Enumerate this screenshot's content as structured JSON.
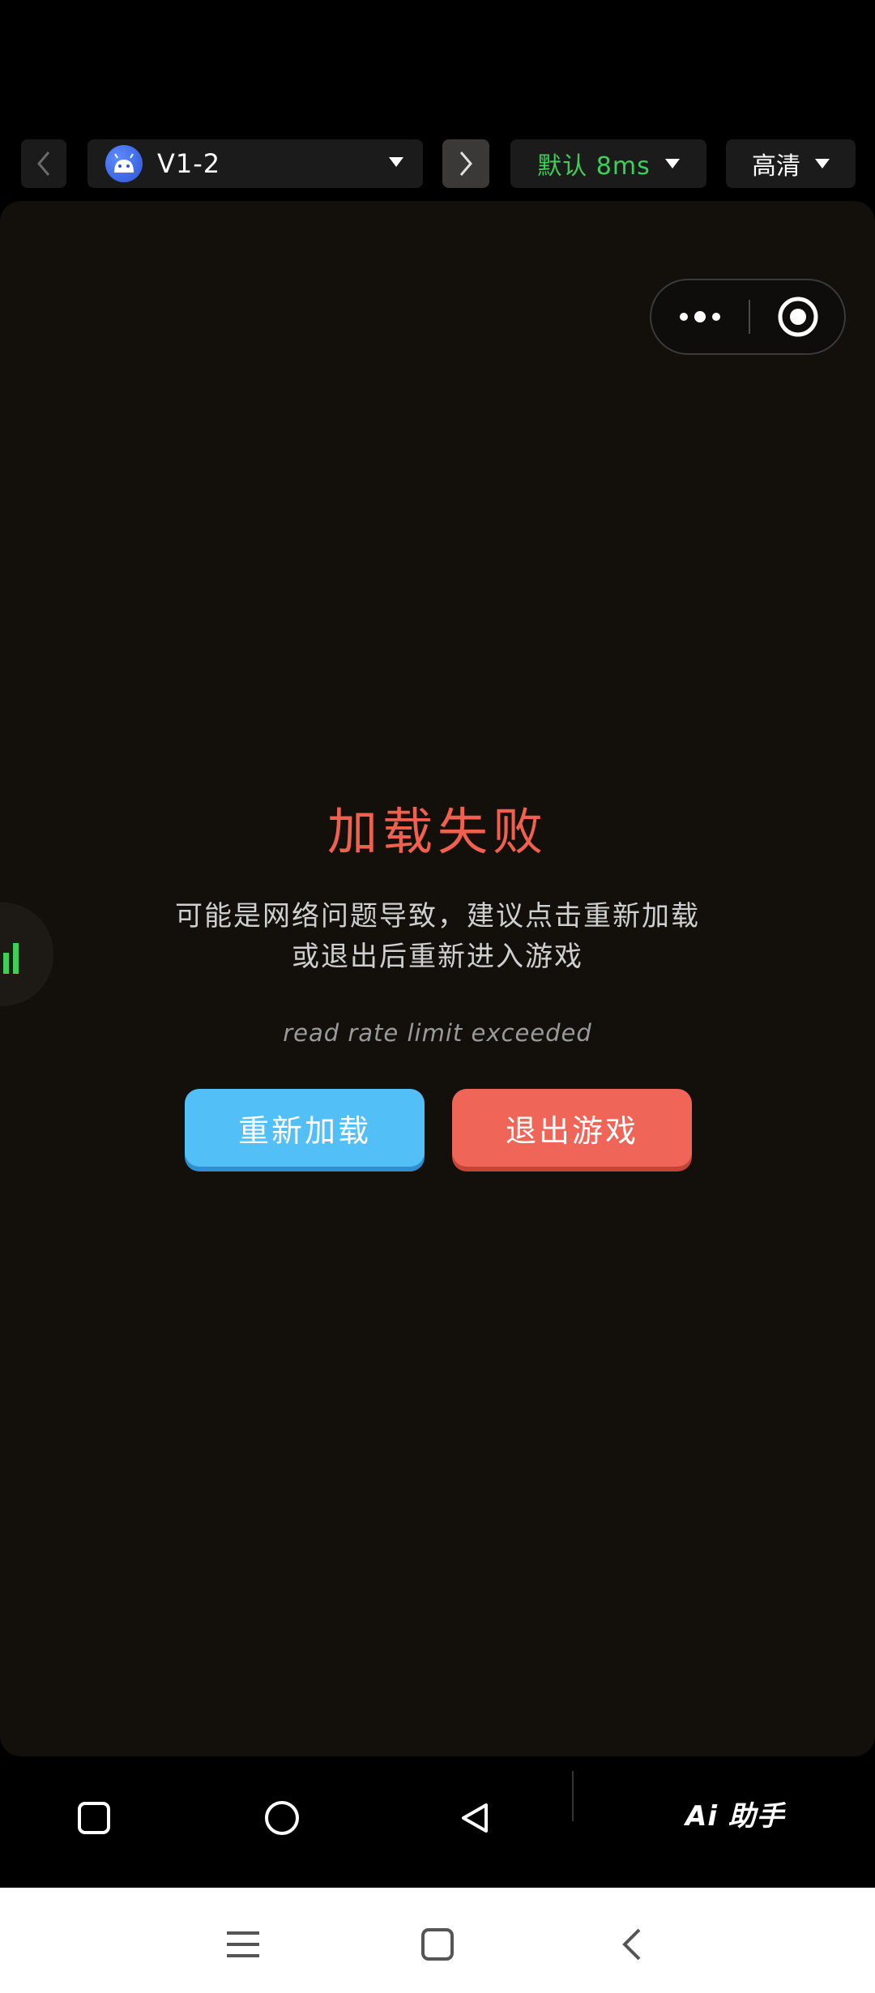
{
  "toolbar": {
    "server_label": "V1-2",
    "latency_label": "默认 8ms",
    "quality_label": "高清",
    "colors": {
      "latency": "#3ecf58",
      "background": "#1b1b1b"
    }
  },
  "game": {
    "error_title": "加载失败",
    "error_desc_line1": "可能是网络问题导致，建议点击重新加载",
    "error_desc_line2": "或退出后重新进入游戏",
    "error_detail": "read rate limit exceeded",
    "reload_label": "重新加载",
    "exit_label": "退出游戏",
    "colors": {
      "title": "#f0604e",
      "reload": "#52bff7",
      "exit": "#ef6658"
    }
  },
  "navbar": {
    "ai_label": "Ai 助手",
    "icons": [
      "square-icon",
      "circle-icon",
      "triangle-back-icon"
    ]
  },
  "sysbar": {
    "icons": [
      "menu-icon",
      "home-square-icon",
      "back-chevron-icon"
    ]
  }
}
